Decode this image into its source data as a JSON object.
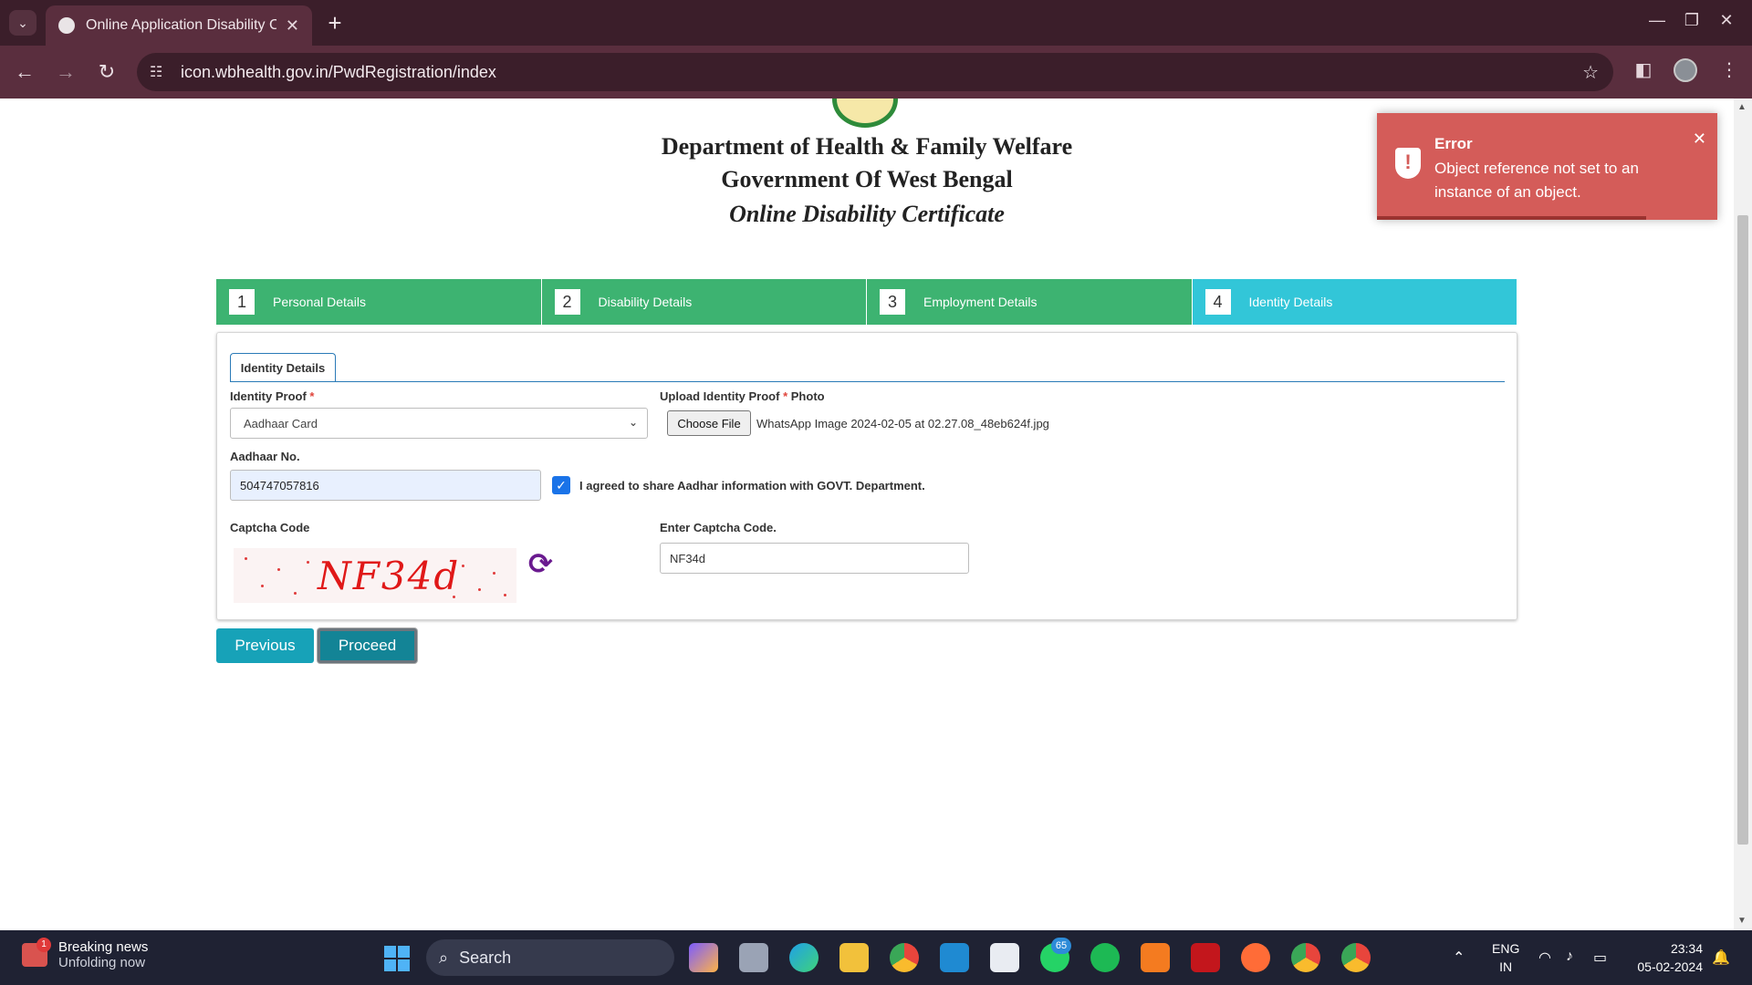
{
  "browser": {
    "tab_title": "Online Application Disability Ce",
    "url": "icon.wbhealth.gov.in/PwdRegistration/index"
  },
  "header": {
    "line1": "Department of Health & Family Welfare",
    "line2": "Government Of West Bengal",
    "line3": "Online Disability Certificate"
  },
  "steps": [
    {
      "num": "1",
      "label": "Personal Details"
    },
    {
      "num": "2",
      "label": "Disability Details"
    },
    {
      "num": "3",
      "label": "Employment Details"
    },
    {
      "num": "4",
      "label": "Identity Details"
    }
  ],
  "form": {
    "tab_label": "Identity Details",
    "identity_proof_label": "Identity Proof",
    "required_mark": "*",
    "identity_proof_value": "Aadhaar Card",
    "upload_label": "Upload Identity Proof",
    "upload_label_suffix": "Photo",
    "choose_file_label": "Choose File",
    "file_name": "WhatsApp Image 2024-02-05 at 02.27.08_48eb624f.jpg",
    "aadhaar_label": "Aadhaar No.",
    "aadhaar_value": "504747057816",
    "agree_text": "I agreed to share Aadhar information with GOVT. Department.",
    "captcha_label": "Captcha Code",
    "captcha_image_text": "NF34d",
    "enter_captcha_label": "Enter Captcha Code.",
    "captcha_value": "NF34d"
  },
  "buttons": {
    "previous": "Previous",
    "proceed": "Proceed"
  },
  "toast": {
    "title": "Error",
    "message": "Object reference not set to an instance of an object.",
    "color": "#d45c59"
  },
  "taskbar": {
    "news_title": "Breaking news",
    "news_subtitle": "Unfolding now",
    "news_badge": "1",
    "search_label": "Search",
    "whatsapp_badge": "65",
    "lang_line1": "ENG",
    "lang_line2": "IN",
    "time": "23:34",
    "date": "05-02-2024"
  },
  "colors": {
    "step_done": "#3db371",
    "step_active": "#32c6d8",
    "button": "#17a2b8"
  }
}
